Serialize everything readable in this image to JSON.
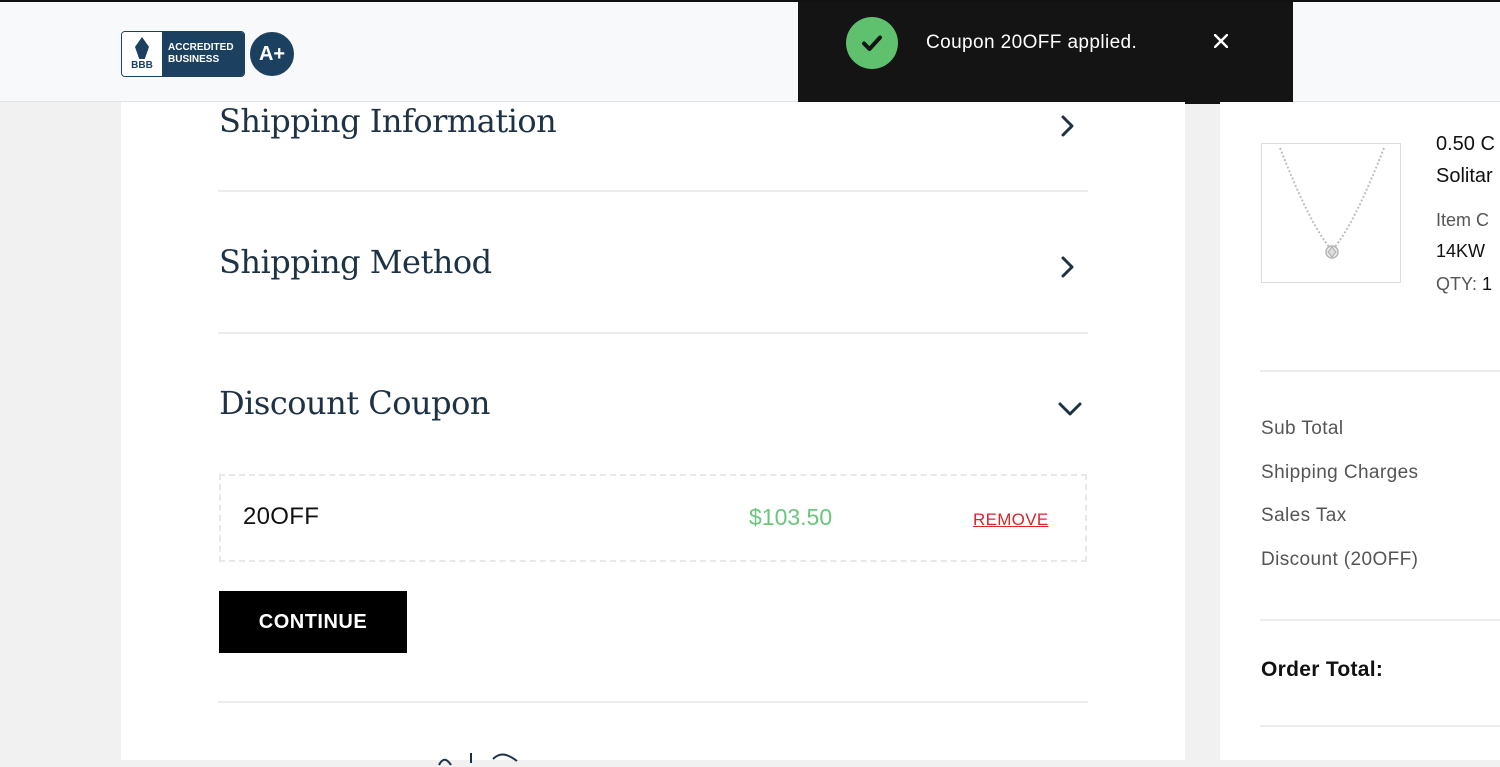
{
  "header": {
    "bbb": {
      "torch_letters": "BBB",
      "line1": "ACCREDITED",
      "line2": "BUSINESS",
      "grade": "A+"
    }
  },
  "toast": {
    "message": "Coupon 20OFF applied.",
    "icon": "check-icon",
    "close_icon": "close-icon",
    "colors": {
      "background": "#141414",
      "check": "#5fc06e"
    }
  },
  "checkout": {
    "sections": [
      {
        "title": "Shipping Information",
        "state": "collapsed"
      },
      {
        "title": "Shipping Method",
        "state": "collapsed"
      },
      {
        "title": "Discount Coupon",
        "state": "expanded"
      }
    ],
    "coupon": {
      "code": "20OFF",
      "amount": "$103.50",
      "remove_label": "REMOVE"
    },
    "continue_label": "CONTINUE"
  },
  "order_summary": {
    "product": {
      "name_line1": "0.50 C",
      "name_line2": "Solitar",
      "item_label": "Item C",
      "metal": "14KW",
      "qty_label": "QTY:",
      "qty_value": "1"
    },
    "rows": [
      "Sub Total",
      "Shipping Charges",
      "Sales Tax",
      "Discount (20OFF)"
    ],
    "order_total_label": "Order Total:"
  },
  "colors": {
    "heading": "#1e3246",
    "discount_amount": "#6ac77a",
    "remove_link": "#d8262f",
    "bbb_blue": "#1c4060"
  }
}
